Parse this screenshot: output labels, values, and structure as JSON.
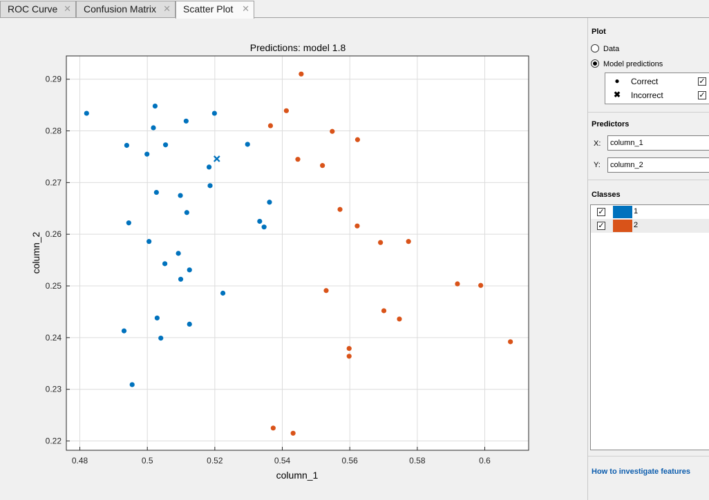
{
  "tabs": [
    {
      "label": "ROC Curve",
      "active": false
    },
    {
      "label": "Confusion Matrix",
      "active": false
    },
    {
      "label": "Scatter Plot",
      "active": true
    }
  ],
  "close_glyph": "✕",
  "panel": {
    "plot_title": "Plot",
    "data_option": "Data",
    "model_option": "Model predictions",
    "selected_option": "Model predictions",
    "legend": {
      "correct_label": "Correct",
      "incorrect_label": "Incorrect",
      "correct_checked": true,
      "incorrect_checked": true
    },
    "predictors_title": "Predictors",
    "x_label": "X:",
    "x_value": "column_1",
    "y_label": "Y:",
    "y_value": "column_2",
    "classes_title": "Classes",
    "classes": [
      {
        "label": "1",
        "color": "#0072bd",
        "checked": true
      },
      {
        "label": "2",
        "color": "#d95319",
        "checked": true
      }
    ],
    "help_link": "How to investigate features"
  },
  "chart_data": {
    "type": "scatter",
    "title": "Predictions: model 1.8",
    "xlabel": "column_1",
    "ylabel": "column_2",
    "xlim": [
      0.476,
      0.613
    ],
    "ylim": [
      0.2182,
      0.2945
    ],
    "xticks": [
      0.48,
      0.5,
      0.52,
      0.54,
      0.56,
      0.58,
      0.6
    ],
    "xtick_labels": [
      "0.48",
      "0.5",
      "0.52",
      "0.54",
      "0.56",
      "0.58",
      "0.6"
    ],
    "yticks": [
      0.22,
      0.23,
      0.24,
      0.25,
      0.26,
      0.27,
      0.28,
      0.29
    ],
    "ytick_labels": [
      "0.22",
      "0.23",
      "0.24",
      "0.25",
      "0.26",
      "0.27",
      "0.28",
      "0.29"
    ],
    "grid": true,
    "series": [
      {
        "name": "1",
        "color": "#0072bd",
        "correct": [
          [
            0.482,
            0.2834
          ],
          [
            0.5023,
            0.2848
          ],
          [
            0.5199,
            0.2834
          ],
          [
            0.5115,
            0.2819
          ],
          [
            0.5018,
            0.2806
          ],
          [
            0.4939,
            0.2772
          ],
          [
            0.5054,
            0.2773
          ],
          [
            0.4999,
            0.2755
          ],
          [
            0.5297,
            0.2774
          ],
          [
            0.5183,
            0.273
          ],
          [
            0.5186,
            0.2694
          ],
          [
            0.5027,
            0.2681
          ],
          [
            0.5098,
            0.2675
          ],
          [
            0.5362,
            0.2662
          ],
          [
            0.5117,
            0.2642
          ],
          [
            0.4945,
            0.2622
          ],
          [
            0.5333,
            0.2625
          ],
          [
            0.5346,
            0.2614
          ],
          [
            0.5005,
            0.2586
          ],
          [
            0.5092,
            0.2563
          ],
          [
            0.5052,
            0.2543
          ],
          [
            0.5125,
            0.2531
          ],
          [
            0.5099,
            0.2513
          ],
          [
            0.5224,
            0.2486
          ],
          [
            0.5029,
            0.2438
          ],
          [
            0.5125,
            0.2426
          ],
          [
            0.4931,
            0.2413
          ],
          [
            0.504,
            0.2399
          ],
          [
            0.4955,
            0.2309
          ]
        ],
        "incorrect": [
          [
            0.5206,
            0.2746
          ]
        ]
      },
      {
        "name": "2",
        "color": "#d95319",
        "correct": [
          [
            0.5456,
            0.291
          ],
          [
            0.5412,
            0.2839
          ],
          [
            0.5365,
            0.281
          ],
          [
            0.5548,
            0.2799
          ],
          [
            0.5623,
            0.2783
          ],
          [
            0.5446,
            0.2745
          ],
          [
            0.5519,
            0.2733
          ],
          [
            0.5571,
            0.2648
          ],
          [
            0.5622,
            0.2616
          ],
          [
            0.5691,
            0.2584
          ],
          [
            0.5774,
            0.2586
          ],
          [
            0.5919,
            0.2504
          ],
          [
            0.5988,
            0.2501
          ],
          [
            0.553,
            0.2491
          ],
          [
            0.5701,
            0.2452
          ],
          [
            0.5747,
            0.2436
          ],
          [
            0.6076,
            0.2392
          ],
          [
            0.5598,
            0.2379
          ],
          [
            0.5598,
            0.2364
          ],
          [
            0.5373,
            0.2225
          ],
          [
            0.5432,
            0.2215
          ]
        ],
        "incorrect": []
      }
    ]
  }
}
